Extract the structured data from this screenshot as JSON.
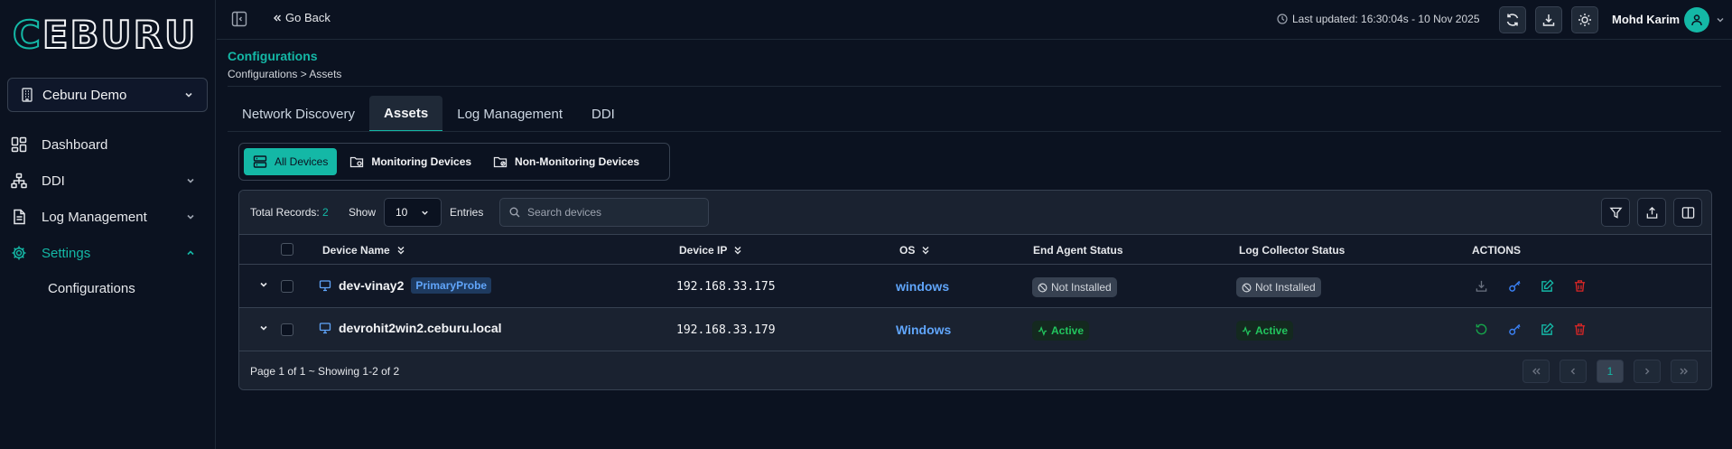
{
  "brand": {
    "logo_text": "CEBURU"
  },
  "sidebar": {
    "org": "Ceburu Demo",
    "items": [
      {
        "label": "Dashboard",
        "icon": "dashboard-icon"
      },
      {
        "label": "DDI",
        "icon": "network-icon"
      },
      {
        "label": "Log Management",
        "icon": "document-icon"
      },
      {
        "label": "Settings",
        "icon": "gear-icon"
      }
    ],
    "sub_items": [
      {
        "label": "Configurations"
      }
    ]
  },
  "topbar": {
    "go_back": "Go Back",
    "last_updated": "Last updated: 16:30:04s - 10 Nov 2025",
    "user_name": "Mohd Karim"
  },
  "page": {
    "title": "Configurations",
    "breadcrumb": "Configurations > Assets"
  },
  "tabs": [
    {
      "label": "Network Discovery"
    },
    {
      "label": "Assets"
    },
    {
      "label": "Log Management"
    },
    {
      "label": "DDI"
    }
  ],
  "filters": [
    {
      "label": "All Devices"
    },
    {
      "label": "Monitoring Devices"
    },
    {
      "label": "Non-Monitoring Devices"
    }
  ],
  "table_toolbar": {
    "total_label": "Total Records:",
    "total_value": "2",
    "show_label": "Show",
    "page_size": "10",
    "entries_label": "Entries",
    "search_placeholder": "Search devices"
  },
  "table": {
    "columns": [
      "Device Name",
      "Device IP",
      "OS",
      "End Agent Status",
      "Log Collector Status",
      "ACTIONS"
    ],
    "rows": [
      {
        "name": "dev-vinay2",
        "tag": "PrimaryProbe",
        "ip": "192.168.33.175",
        "os": "windows",
        "agent_status": "Not Installed",
        "collector_status": "Not Installed"
      },
      {
        "name": "devrohit2win2.ceburu.local",
        "tag": "",
        "ip": "192.168.33.179",
        "os": "Windows",
        "agent_status": "Active",
        "collector_status": "Active"
      }
    ]
  },
  "pagination": {
    "info": "Page 1 of 1 ~ Showing 1-2 of 2",
    "current_page": "1"
  },
  "colors": {
    "accent": "#14b8a6",
    "link": "#60a5fa",
    "success": "#22c55e",
    "danger": "#ef4444"
  }
}
